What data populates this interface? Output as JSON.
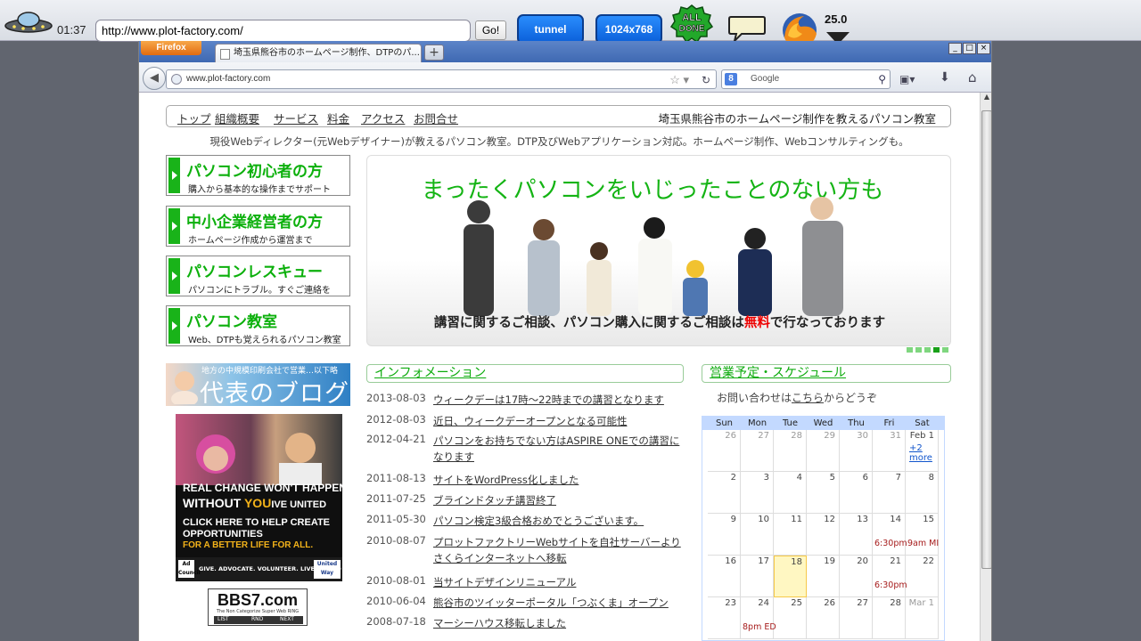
{
  "toolbar": {
    "clock": "01:37",
    "url": "http://www.plot-factory.com/",
    "go_label": "Go!",
    "tunnel_label": "tunnel",
    "resolution_label": "1024x768",
    "alldone_label": "ALL DONE",
    "zoom": "25.0"
  },
  "browser": {
    "menu_label": "Firefox",
    "tab_title": "埼玉県熊谷市のホームページ制作、DTPのパ...",
    "newtab_label": "+",
    "address": "www.plot-factory.com",
    "search_placeholder": "Google",
    "search_engine_icon": "8",
    "window_min": "_",
    "window_max": "□",
    "window_close": "×"
  },
  "site": {
    "nav": [
      "トップ",
      "組織概要",
      "サービス",
      "料金",
      "アクセス",
      "お問合せ"
    ],
    "tagline": "埼玉県熊谷市のホームページ制作を教えるパソコン教室",
    "description": "現役Webディレクター(元Webデザイナー)が教えるパソコン教室。DTP及びWebアプリケーション対応。ホームページ制作、Webコンサルティングも。",
    "left_links": [
      {
        "title": "パソコン初心者の方",
        "sub": "購入から基本的な操作までサポート"
      },
      {
        "title": "中小企業経営者の方",
        "sub": "ホームページ作成から運営まで"
      },
      {
        "title": "パソコンレスキュー",
        "sub": "パソコンにトラブル。すぐご連絡を"
      },
      {
        "title": "パソコン教室",
        "sub": "Web、DTPも覚えられるパソコン教室"
      }
    ],
    "hero": {
      "headline": "まったくパソコンをいじったことのない方も",
      "caption_pre": "講習に関するご相談、パソコン購入に関するご相談は",
      "caption_red": "無料",
      "caption_post": "で行なっております",
      "slide_count": 5,
      "active_slide": 4
    },
    "blog_banner": {
      "top": "地方の中規模印刷会社で営業…以下略",
      "title": "代表のブログ"
    },
    "ad": {
      "line1": "REAL CHANGE WON'T HAPPEN",
      "line2_pre": "WITHOUT ",
      "line2_you": "YOU",
      "line2_post": "IVE UNITED",
      "line3": "CLICK HERE TO HELP CREATE",
      "line4": "OPPORTUNITIES",
      "line5": "FOR A BETTER LIFE FOR ALL.",
      "foot": "GIVE. ADVOCATE. VOLUNTEER. LIVE UNITED",
      "ad_council": "Ad Council",
      "united_way": "United Way"
    },
    "bbs": {
      "name": "BBS7.com",
      "sub": "The Non Categorize Super Web RING",
      "list": "LIST",
      "rnd": "RND",
      "next": "NEXT"
    },
    "info_title": "インフォメーション",
    "info": [
      {
        "date": "2013-08-03",
        "text": "ウィークデーは17時〜22時までの講習となります"
      },
      {
        "date": "2012-08-03",
        "text": "近日、ウィークデーオープンとなる可能性"
      },
      {
        "date": "2012-04-21",
        "text": "パソコンをお持ちでない方はASPIRE ONEでの講習になります"
      },
      {
        "date": "2011-08-13",
        "text": "サイトをWordPress化しました"
      },
      {
        "date": "2011-07-25",
        "text": "ブラインドタッチ講習終了"
      },
      {
        "date": "2011-05-30",
        "text": "パソコン検定3級合格おめでとうございます。"
      },
      {
        "date": "2010-08-07",
        "text": "プロットファクトリーWebサイトを自社サーバーよりさくらインターネットへ移転"
      },
      {
        "date": "2010-08-01",
        "text": "当サイトデザインリニューアル"
      },
      {
        "date": "2010-06-04",
        "text": "熊谷市のツイッターポータル「つぶくま」オープン"
      },
      {
        "date": "2008-07-18",
        "text": "マーシーハウス移転しました"
      }
    ],
    "schedule_title": "営業予定・スケジュール",
    "ask_pre": "お問い合わせは",
    "ask_link": "こちら",
    "ask_post": "からどうぞ",
    "calendar": {
      "days": [
        "Sun",
        "Mon",
        "Tue",
        "Wed",
        "Thu",
        "Fri",
        "Sat"
      ],
      "weeks": [
        [
          {
            "n": "26",
            "g": true
          },
          {
            "n": "27",
            "g": true
          },
          {
            "n": "28",
            "g": true
          },
          {
            "n": "29",
            "g": true
          },
          {
            "n": "30",
            "g": true
          },
          {
            "n": "31",
            "g": true
          },
          {
            "n": "Feb 1",
            "more": "+2 more"
          }
        ],
        [
          {
            "n": "2"
          },
          {
            "n": "3"
          },
          {
            "n": "4"
          },
          {
            "n": "5"
          },
          {
            "n": "6"
          },
          {
            "n": "7"
          },
          {
            "n": "8"
          }
        ],
        [
          {
            "n": "9"
          },
          {
            "n": "10"
          },
          {
            "n": "11"
          },
          {
            "n": "12"
          },
          {
            "n": "13"
          },
          {
            "n": "14",
            "ev": "6:30pm"
          },
          {
            "n": "15",
            "ev": "9am MI"
          }
        ],
        [
          {
            "n": "16"
          },
          {
            "n": "17"
          },
          {
            "n": "18",
            "today": true
          },
          {
            "n": "19"
          },
          {
            "n": "20"
          },
          {
            "n": "21",
            "ev": "6:30pm"
          },
          {
            "n": "22"
          }
        ],
        [
          {
            "n": "23"
          },
          {
            "n": "24",
            "ev": "8pm ED"
          },
          {
            "n": "25"
          },
          {
            "n": "26"
          },
          {
            "n": "27"
          },
          {
            "n": "28"
          },
          {
            "n": "Mar 1",
            "g": true
          }
        ]
      ]
    }
  },
  "colors": {
    "accent_green": "#0cb00c",
    "toolbar_blue": "#0a5fd9",
    "event_red": "#a61c1c"
  }
}
